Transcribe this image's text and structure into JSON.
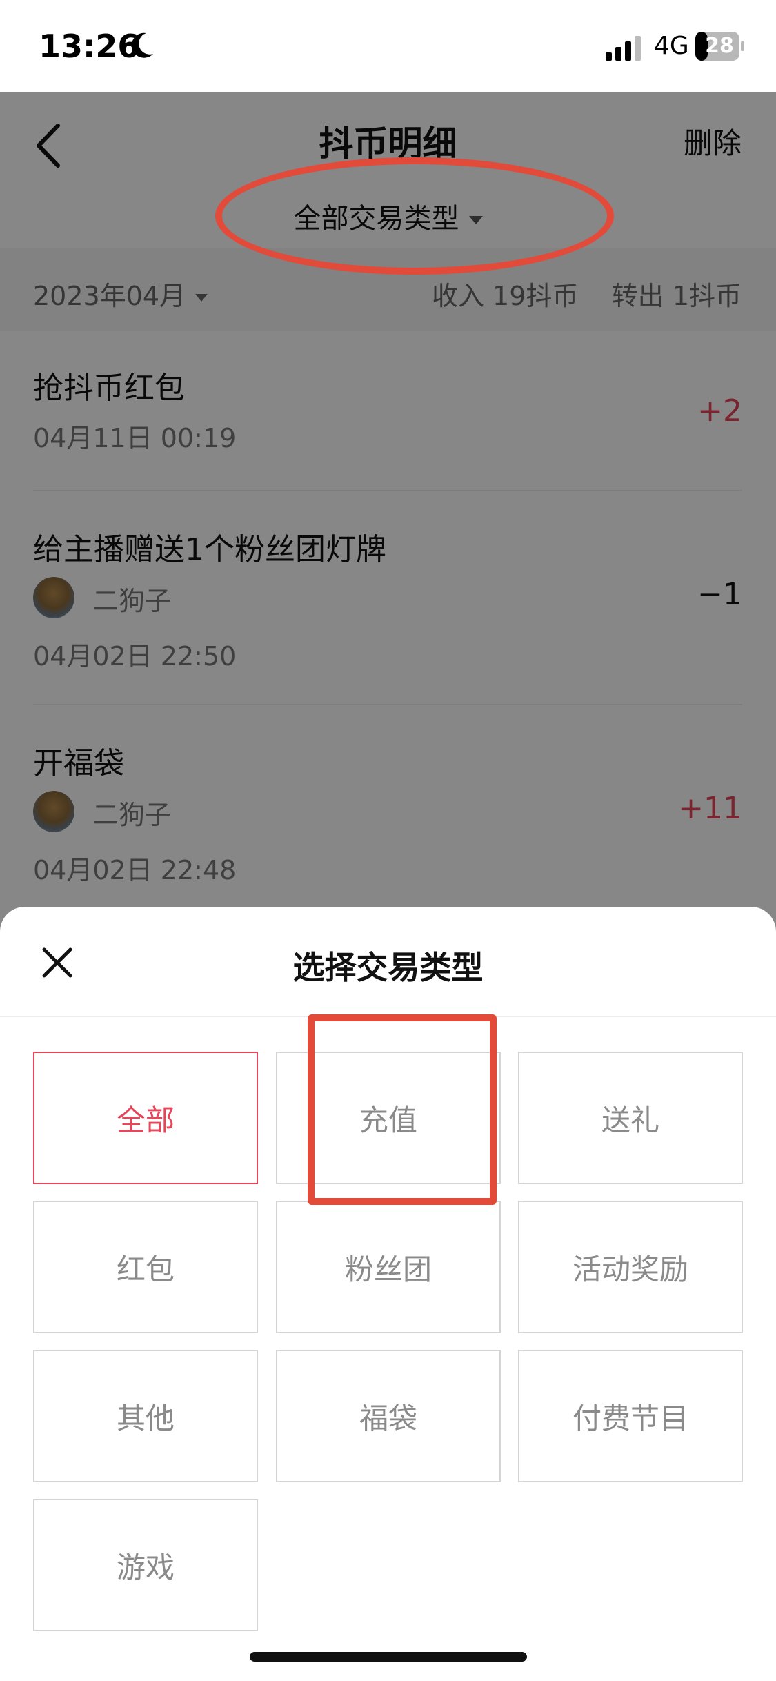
{
  "status_bar": {
    "time": "13:26",
    "network": "4G",
    "battery": "28"
  },
  "nav": {
    "title": "抖币明细",
    "delete": "删除",
    "filter": "全部交易类型"
  },
  "summary": {
    "month": "2023年04月",
    "income": "收入 19抖币",
    "out": "转出 1抖币"
  },
  "transactions": [
    {
      "title": "抢抖币红包",
      "time": "04月11日 00:19",
      "amount": "+2",
      "color": "#e6455a"
    },
    {
      "title": "给主播赠送1个粉丝团灯牌",
      "user": "二狗子",
      "time": "04月02日 22:50",
      "amount": "−1",
      "color": "#111111"
    },
    {
      "title": "开福袋",
      "user": "二狗子",
      "time": "04月02日 22:48",
      "amount": "+11",
      "color": "#e6455a"
    }
  ],
  "sheet": {
    "title": "选择交易类型",
    "options": [
      {
        "label": "全部",
        "selected": true
      },
      {
        "label": "充值"
      },
      {
        "label": "送礼"
      },
      {
        "label": "红包"
      },
      {
        "label": "粉丝团"
      },
      {
        "label": "活动奖励"
      },
      {
        "label": "其他"
      },
      {
        "label": "福袋"
      },
      {
        "label": "付费节目"
      },
      {
        "label": "游戏"
      }
    ]
  },
  "icons": {
    "back": "chevron-left-icon",
    "close": "close-icon",
    "moon": "moon-icon"
  },
  "colors": {
    "accent": "#e6455a",
    "annotation": "#e24a3a"
  }
}
